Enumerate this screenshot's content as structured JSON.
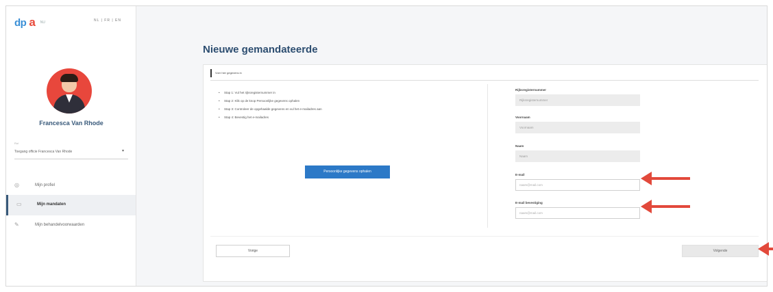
{
  "sidebar": {
    "logo_part1": "dp",
    "logo_part2": "a",
    "logo_part3": "NU",
    "lang": "NL | FR | EN",
    "user_name": "Francesca Van Rhode",
    "role_caption": "Rol",
    "role_value": "Toegang officie Francesca Van Rhode",
    "items": [
      {
        "label": "Mijn profiel",
        "icon": "user-icon"
      },
      {
        "label": "Mijn mandaten",
        "icon": "document-icon"
      },
      {
        "label": "Mijn behandelvoorwaarden",
        "icon": "wrench-icon"
      }
    ]
  },
  "main": {
    "title": "Nieuwe gemandateerde",
    "breadcrumb": "Voer hier gegevens in",
    "steps": [
      "Stap 1: Vul het rijksregisternummer in",
      "Stap 2: Klik op de knop Persoonlijke gegevens ophalen",
      "Stap 3: Controleer de opgehaalde gegevens en vul het e-mailadres aan",
      "Stap 4: Bevestig het e-mailadres"
    ],
    "update_button": "Persoonlijke gegevens ophalen",
    "fields": [
      {
        "label": "Rijksregisternummer",
        "placeholder": "Rijksregisternummer",
        "readonly": true
      },
      {
        "label": "Voornaam",
        "placeholder": "Voornaam",
        "readonly": true
      },
      {
        "label": "Naam",
        "placeholder": "Naam",
        "readonly": true
      },
      {
        "label": "E-mail",
        "placeholder": "naam@mail.com",
        "readonly": false
      },
      {
        "label": "E-mail bevestiging",
        "placeholder": "naam@mail.com",
        "readonly": false
      }
    ],
    "back_button": "Vorige",
    "submit_button": "Volgende"
  },
  "colors": {
    "accent": "#2c79c7",
    "title": "#2c4d70",
    "annotation_arrow": "#e2493b",
    "avatar_bg": "#e8473c"
  }
}
